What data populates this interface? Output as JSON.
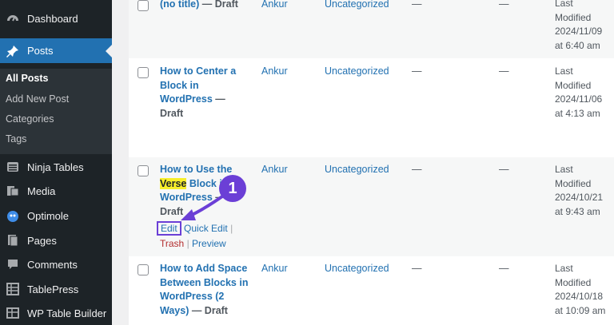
{
  "sidebar": {
    "items": [
      {
        "label": "Dashboard",
        "icon": "dashboard-icon"
      },
      {
        "label": "Posts",
        "icon": "pin-icon",
        "active": true
      },
      {
        "label": "Ninja Tables",
        "icon": "table-icon"
      },
      {
        "label": "Media",
        "icon": "media-icon"
      },
      {
        "label": "Optimole",
        "icon": "optimole-icon"
      },
      {
        "label": "Pages",
        "icon": "pages-icon"
      },
      {
        "label": "Comments",
        "icon": "comment-icon"
      },
      {
        "label": "TablePress",
        "icon": "tablepress-icon"
      },
      {
        "label": "WP Table Builder",
        "icon": "table-builder-icon"
      }
    ],
    "submenu": [
      "All Posts",
      "Add New Post",
      "Categories",
      "Tags"
    ]
  },
  "rows": [
    {
      "title": "(no title)",
      "title_suffix": " — Draft",
      "author": "Ankur",
      "category": "Uncategorized",
      "tags": "—",
      "comments": "—",
      "date_lines": [
        "Last",
        "Modified",
        "2024/11/09",
        "at 6:40 am"
      ]
    },
    {
      "title_lines": [
        "How to Center a",
        "Block in",
        "WordPress"
      ],
      "title_suffix": " —",
      "status": "Draft",
      "author": "Ankur",
      "category": "Uncategorized",
      "tags": "—",
      "comments": "—",
      "date_lines": [
        "Last",
        "Modified",
        "2024/11/06",
        "at 4:13 am"
      ]
    },
    {
      "title_lines": [
        "How to Use the",
        "Verse",
        " Block in",
        "WordPress"
      ],
      "title_suffix": " —",
      "status": "Draft",
      "author": "Ankur",
      "category": "Uncategorized",
      "tags": "—",
      "comments": "—",
      "date_lines": [
        "Last",
        "Modified",
        "2024/10/21",
        "at 9:43 am"
      ],
      "actions": {
        "edit": "Edit",
        "quick_edit": "Quick Edit",
        "trash": "Trash",
        "preview": "Preview",
        "sep": "|"
      }
    },
    {
      "title_lines": [
        "How to Add Space",
        "Between Blocks in",
        "WordPress (2",
        "Ways)"
      ],
      "title_suffix": " — Draft",
      "author": "Ankur",
      "category": "Uncategorized",
      "tags": "—",
      "comments": "—",
      "date_lines": [
        "Last",
        "Modified",
        "2024/10/18",
        "at 10:09 am"
      ]
    }
  ],
  "annotation": {
    "number": "1",
    "color": "#6b3fd6"
  },
  "colors": {
    "sidebar": "#1d2327",
    "accent": "#2271b1",
    "trash": "#b32d2e",
    "highlight": "#f7ef2b"
  }
}
